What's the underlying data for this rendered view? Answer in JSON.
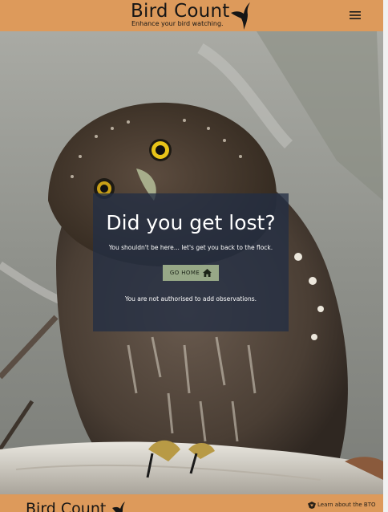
{
  "header": {
    "brand_title": "Bird Count",
    "brand_tagline": "Enhance your bird watching."
  },
  "error": {
    "title": "Did you get lost?",
    "message": "You shouldn't be here... let's get you back to the flock.",
    "home_button": "GO HOME",
    "auth_note": "You are not authorised to add observations."
  },
  "footer": {
    "brand_title": "Bird Count",
    "link_label": "Learn about the BTO"
  },
  "colors": {
    "header_bg": "#dd9a5b",
    "card_bg": "#232e44",
    "button_bg": "#97a887"
  },
  "icons": {
    "menu": "hamburger-menu-icon",
    "brand": "bird-logo-icon",
    "home": "home-icon",
    "bto": "bto-logo-icon"
  }
}
